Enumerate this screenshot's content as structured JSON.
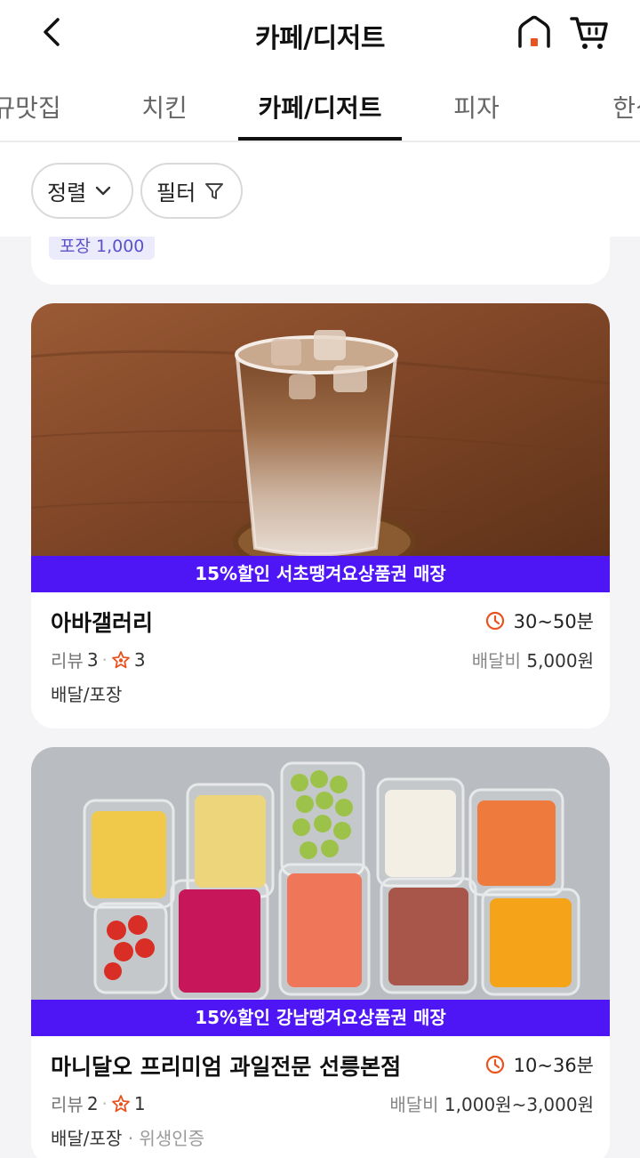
{
  "header": {
    "title": "카페/디저트",
    "back_icon": "chevron-left-icon",
    "home_icon": "home-icon",
    "cart_icon": "cart-icon",
    "accent": "#e8531f"
  },
  "tabs": [
    {
      "label": "규맛집",
      "active": false
    },
    {
      "label": "치킨",
      "active": false
    },
    {
      "label": "카페/디저트",
      "active": true
    },
    {
      "label": "피자",
      "active": false
    },
    {
      "label": "한식",
      "active": false
    }
  ],
  "filters": {
    "sort_label": "정렬",
    "filter_label": "필터"
  },
  "prev_card": {
    "reward": "포장 1,000"
  },
  "stores": [
    {
      "promo": "15%할인 서초땡겨요상품권 매장",
      "name": "아바갤러리",
      "time": "30~50분",
      "review_label": "리뷰",
      "review_count": "3",
      "rating_count": "3",
      "fee_label": "배달비",
      "fee": "5,000원",
      "service": "배달/포장",
      "service_extra": ""
    },
    {
      "promo": "15%할인 강남땡겨요상품권 매장",
      "name": "마니달오 프리미엄 과일전문 선릉본점",
      "time": "10~36분",
      "review_label": "리뷰",
      "review_count": "2",
      "rating_count": "1",
      "fee_label": "배달비",
      "fee": "1,000원~3,000원",
      "service": "배달/포장",
      "service_extra": "· 위생인증"
    }
  ],
  "colors": {
    "promo_bar": "#4f16f5",
    "clock": "#e8531f"
  }
}
